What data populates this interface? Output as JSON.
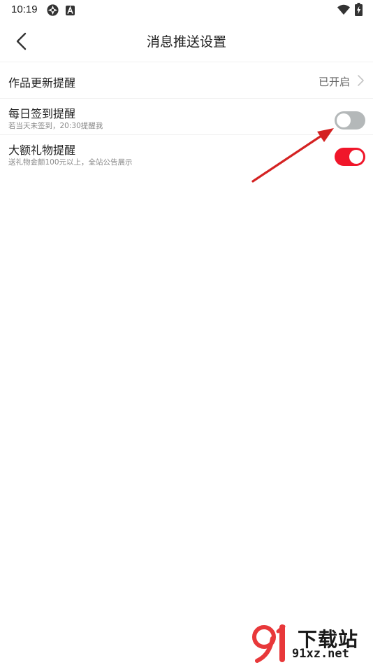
{
  "status_bar": {
    "time": "10:19",
    "left_icons": [
      "settings-flower-icon",
      "a-badge-icon"
    ],
    "right_icons": [
      "wifi-icon",
      "battery-charging-icon"
    ]
  },
  "header": {
    "back_icon": "chevron-left-icon",
    "title": "消息推送设置"
  },
  "rows": [
    {
      "title": "作品更新提醒",
      "value": "已开启",
      "control": "chevron-right-icon"
    },
    {
      "title": "每日签到提醒",
      "subtitle": "若当天未签到，20:30提醒我",
      "toggle_on": false
    },
    {
      "title": "大额礼物提醒",
      "subtitle": "送礼物金额100元以上，全站公告展示",
      "toggle_on": true
    }
  ],
  "colors": {
    "accent": "#f0162a",
    "toggle_off": "#b4b8b9",
    "annotation_arrow": "#d42222",
    "watermark_red": "#e8383a"
  },
  "watermark": {
    "logo_text": "91",
    "cn_text": "下载站",
    "url": "91xz.net"
  }
}
